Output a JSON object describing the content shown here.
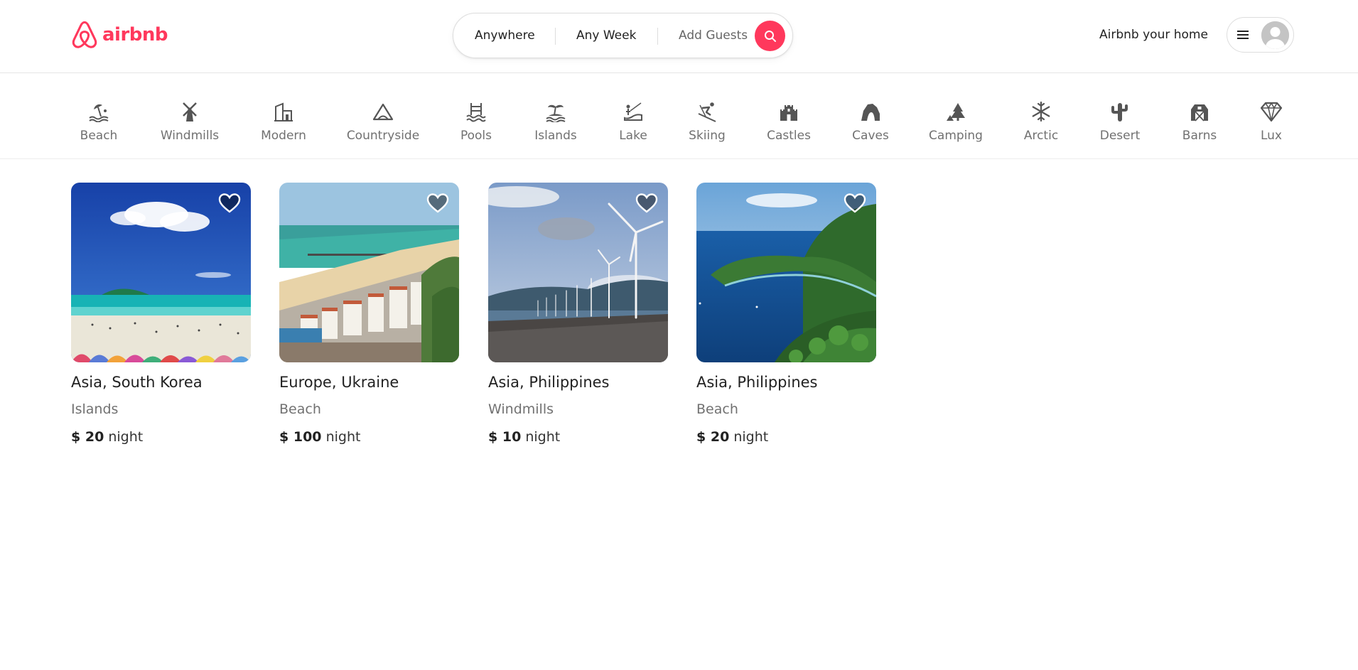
{
  "header": {
    "logo_text": "airbnb",
    "search": {
      "anywhere": "Anywhere",
      "any_week": "Any Week",
      "add_guests": "Add Guests"
    },
    "host_link": "Airbnb your home",
    "brand_color": "#ff385c"
  },
  "categories": [
    {
      "label": "Beach",
      "icon": "beach-icon"
    },
    {
      "label": "Windmills",
      "icon": "windmill-icon"
    },
    {
      "label": "Modern",
      "icon": "modern-house-icon"
    },
    {
      "label": "Countryside",
      "icon": "mountain-icon"
    },
    {
      "label": "Pools",
      "icon": "pool-icon"
    },
    {
      "label": "Islands",
      "icon": "island-icon"
    },
    {
      "label": "Lake",
      "icon": "lake-icon"
    },
    {
      "label": "Skiing",
      "icon": "skiing-icon"
    },
    {
      "label": "Castles",
      "icon": "castle-icon"
    },
    {
      "label": "Caves",
      "icon": "cave-icon"
    },
    {
      "label": "Camping",
      "icon": "camping-icon"
    },
    {
      "label": "Arctic",
      "icon": "snowflake-icon"
    },
    {
      "label": "Desert",
      "icon": "cactus-icon"
    },
    {
      "label": "Barns",
      "icon": "barn-icon"
    },
    {
      "label": "Lux",
      "icon": "diamond-icon"
    }
  ],
  "listings": [
    {
      "location": "Asia, South Korea",
      "category": "Islands",
      "currency": "$",
      "price": "20",
      "unit": "night",
      "image": "beach-with-island-photo"
    },
    {
      "location": "Europe, Ukraine",
      "category": "Beach",
      "currency": "$",
      "price": "100",
      "unit": "night",
      "image": "coastal-town-photo"
    },
    {
      "location": "Asia, Philippines",
      "category": "Windmills",
      "currency": "$",
      "price": "10",
      "unit": "night",
      "image": "wind-turbines-photo"
    },
    {
      "location": "Asia, Philippines",
      "category": "Beach",
      "currency": "$",
      "price": "20",
      "unit": "night",
      "image": "tropical-bay-photo"
    }
  ]
}
